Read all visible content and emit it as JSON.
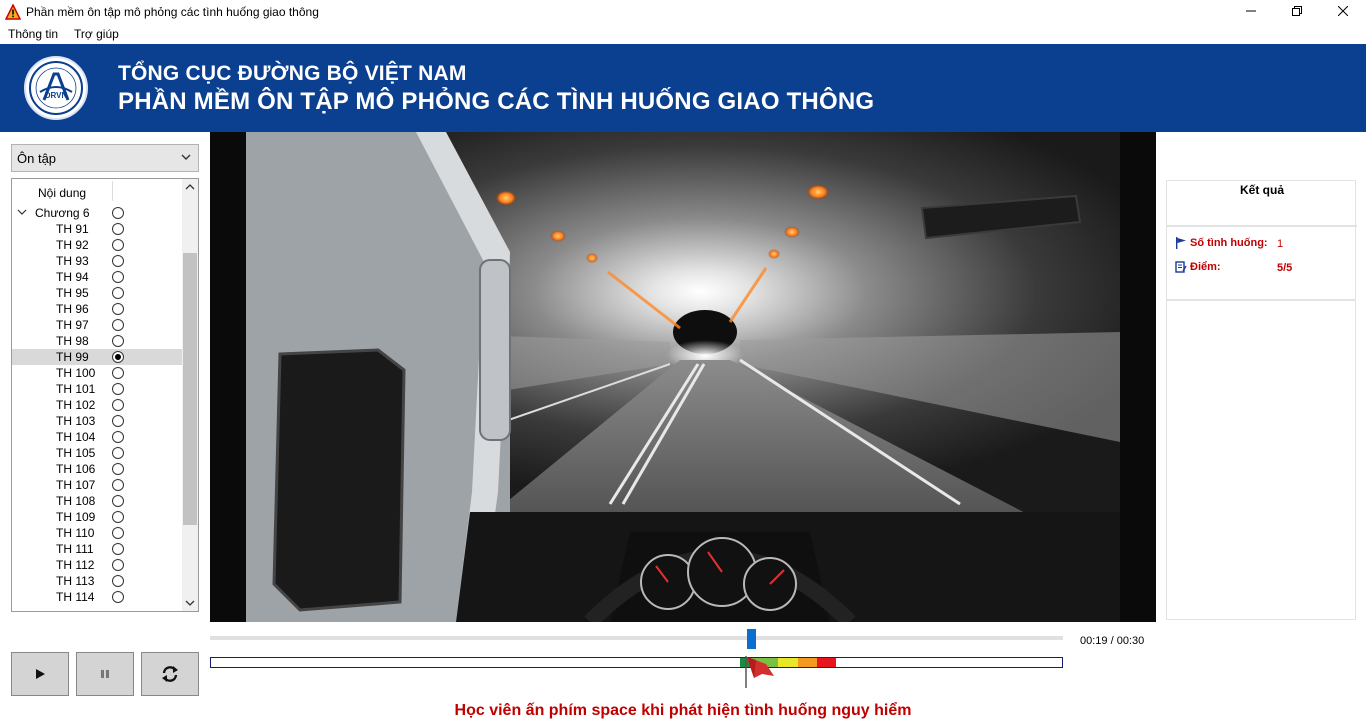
{
  "window": {
    "title": "Phần mềm ôn tập mô phỏng các tình huống giao thông",
    "minimize": "—",
    "restore": "❐",
    "close": "✕"
  },
  "menu": {
    "items": [
      "Thông tin",
      "Trợ giúp"
    ]
  },
  "banner": {
    "org": "TỔNG CỤC ĐƯỜNG BỘ VIỆT NAM",
    "app": "PHẦN MỀM ÔN TẬP MÔ PHỎNG CÁC TÌNH HUỐNG GIAO THÔNG",
    "logo_text": "DRVN",
    "background": "#0b3f8f"
  },
  "mode": {
    "selected": "Ôn tập"
  },
  "tree": {
    "header": "Nội dung",
    "chapter": "Chương 6",
    "items": [
      {
        "label": "TH 91",
        "checked": false
      },
      {
        "label": "TH 92",
        "checked": false
      },
      {
        "label": "TH 93",
        "checked": false
      },
      {
        "label": "TH 94",
        "checked": false
      },
      {
        "label": "TH 95",
        "checked": false
      },
      {
        "label": "TH 96",
        "checked": false
      },
      {
        "label": "TH 97",
        "checked": false
      },
      {
        "label": "TH 98",
        "checked": false
      },
      {
        "label": "TH 99",
        "checked": true
      },
      {
        "label": "TH 100",
        "checked": false
      },
      {
        "label": "TH 101",
        "checked": false
      },
      {
        "label": "TH 102",
        "checked": false
      },
      {
        "label": "TH 103",
        "checked": false
      },
      {
        "label": "TH 104",
        "checked": false
      },
      {
        "label": "TH 105",
        "checked": false
      },
      {
        "label": "TH 106",
        "checked": false
      },
      {
        "label": "TH 107",
        "checked": false
      },
      {
        "label": "TH 108",
        "checked": false
      },
      {
        "label": "TH 109",
        "checked": false
      },
      {
        "label": "TH 110",
        "checked": false
      },
      {
        "label": "TH 111",
        "checked": false
      },
      {
        "label": "TH 112",
        "checked": false
      },
      {
        "label": "TH 113",
        "checked": false
      },
      {
        "label": "TH 114",
        "checked": false
      }
    ],
    "selected_index": 8
  },
  "controls": {
    "play_icon": "play-icon",
    "pause_icon": "pause-icon",
    "replay_icon": "replay-icon"
  },
  "results": {
    "title": "Kết quả",
    "situations_label": "Số tình huống:",
    "situations_value": "1",
    "score_label": "Điểm:",
    "score_value": "5/5",
    "accent": "#c00000"
  },
  "playback": {
    "time": "00:19 / 00:30",
    "progress": 0.633
  },
  "timeline": {
    "flag_color": "#d32f2f",
    "segments": [
      {
        "color": "#1e8a3c"
      },
      {
        "color": "#7bc043"
      },
      {
        "color": "#e8e82a"
      },
      {
        "color": "#f39a1e"
      },
      {
        "color": "#e8141e"
      }
    ]
  },
  "instruction": "Học viên ấn phím space khi phát hiện tình huống nguy hiểm"
}
